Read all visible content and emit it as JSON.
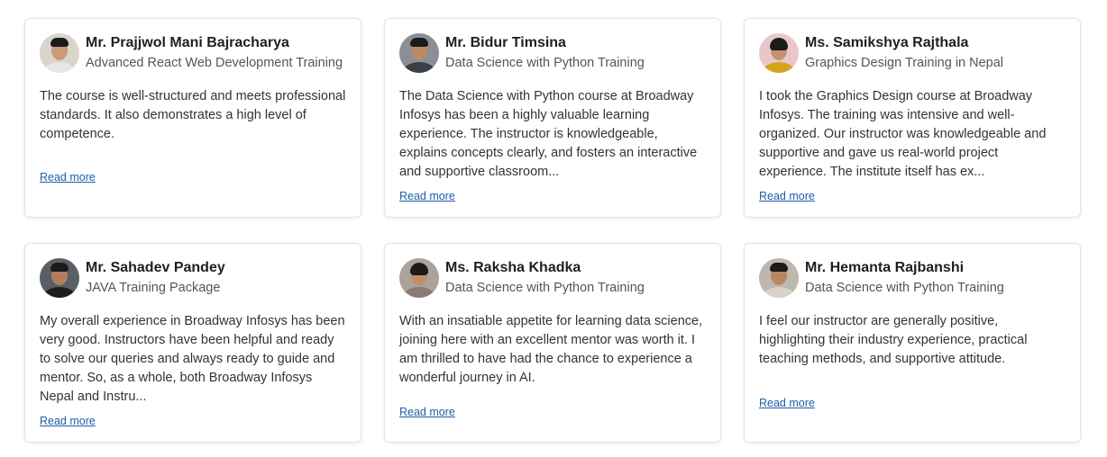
{
  "testimonials": [
    {
      "name": "Mr. Prajjwol Mani Bajracharya",
      "course": "Advanced React Web Development Training",
      "text": "The course is well-structured and meets professional standards. It also demonstrates a high level of competence.",
      "read_more": "Read more",
      "avatar_bg": "#d9d4cc",
      "skin": "#c99b7a",
      "shirt": "#e8e6e3"
    },
    {
      "name": "Mr. Bidur Timsina",
      "course": "Data Science with Python Training",
      "text": "The Data Science with Python course at Broadway Infosys has been a highly valuable learning experience. The instructor is knowledgeable, explains concepts clearly, and fosters an interactive and supportive classroom...",
      "read_more": "Read more",
      "avatar_bg": "#8a8f95",
      "skin": "#b98a68",
      "shirt": "#3a3f46"
    },
    {
      "name": "Ms. Samikshya Rajthala",
      "course": "Graphics Design Training in Nepal",
      "text": "I took the Graphics Design course at Broadway Infosys. The training was intensive and well-organized. Our instructor was knowledgeable and supportive and gave us real-world project experience. The institute itself has ex...",
      "read_more": "Read more",
      "avatar_bg": "#e9c7c9",
      "skin": "#c69270",
      "shirt": "#d4a41c"
    },
    {
      "name": "Mr. Sahadev Pandey",
      "course": "JAVA Training Package",
      "text": "My overall experience in Broadway Infosys has been very good. Instructors have been helpful and ready to solve our queries and always ready to guide and mentor. So, as a whole, both Broadway Infosys Nepal and Instru...",
      "read_more": "Read more",
      "avatar_bg": "#5a5f66",
      "skin": "#b07e5e",
      "shirt": "#1c1c1c"
    },
    {
      "name": "Ms. Raksha Khadka",
      "course": "Data Science with Python Training",
      "text": "With an insatiable appetite for learning data science, joining here with an excellent mentor was worth it. I am thrilled to have had the chance to experience a wonderful journey in AI.",
      "read_more": "Read more",
      "avatar_bg": "#a9a39a",
      "skin": "#c28e6a",
      "shirt": "#8a7a78"
    },
    {
      "name": "Mr. Hemanta Rajbanshi",
      "course": "Data Science with Python Training",
      "text": "I feel our instructor are generally positive, highlighting their industry experience, practical teaching methods, and supportive attitude.",
      "read_more": "Read more",
      "avatar_bg": "#bdb7ad",
      "skin": "#b8875f",
      "shirt": "#d8d2c8"
    }
  ],
  "colors": {
    "link": "#1a5fa8",
    "card_border": "#e2e4e7"
  }
}
